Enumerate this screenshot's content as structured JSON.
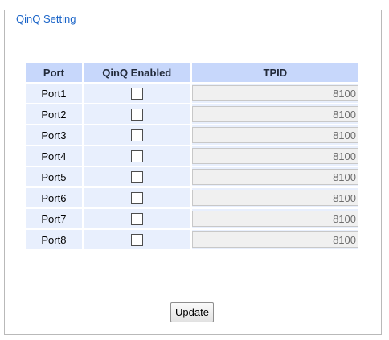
{
  "section": {
    "legend": "QinQ Setting"
  },
  "table": {
    "headers": {
      "port": "Port",
      "qinq_enabled": "QinQ Enabled",
      "tpid": "TPID"
    },
    "rows": [
      {
        "port": "Port1",
        "qinq_enabled": false,
        "tpid": "8100"
      },
      {
        "port": "Port2",
        "qinq_enabled": false,
        "tpid": "8100"
      },
      {
        "port": "Port3",
        "qinq_enabled": false,
        "tpid": "8100"
      },
      {
        "port": "Port4",
        "qinq_enabled": false,
        "tpid": "8100"
      },
      {
        "port": "Port5",
        "qinq_enabled": false,
        "tpid": "8100"
      },
      {
        "port": "Port6",
        "qinq_enabled": false,
        "tpid": "8100"
      },
      {
        "port": "Port7",
        "qinq_enabled": false,
        "tpid": "8100"
      },
      {
        "port": "Port8",
        "qinq_enabled": false,
        "tpid": "8100"
      }
    ]
  },
  "actions": {
    "update_label": "Update"
  },
  "colors": {
    "legend_text": "#1a64c8",
    "header_bg": "#c7d7fb",
    "row_bg": "#e8effd",
    "input_bg": "#f0f0f0",
    "input_text": "#6d6d6d",
    "border": "#b9b9b9"
  }
}
